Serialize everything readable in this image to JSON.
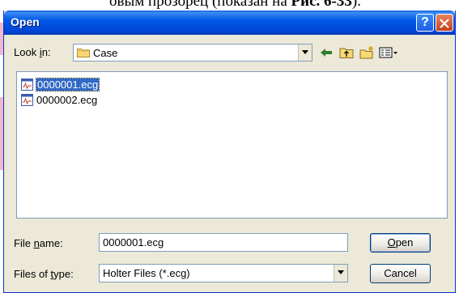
{
  "background_text": {
    "line": "овым прозорец (показан на ",
    "bold": "Рис. 6-33",
    "tail": ")."
  },
  "window": {
    "title": "Open",
    "help_label": "?",
    "close_label": "✕"
  },
  "lookin": {
    "label_pre": "Look ",
    "label_accel": "i",
    "label_post": "n:",
    "value": "Case"
  },
  "files": [
    {
      "name": "0000001.ecg",
      "selected": true
    },
    {
      "name": "0000002.ecg",
      "selected": false
    }
  ],
  "filename": {
    "label_pre": "File ",
    "label_accel": "n",
    "label_post": "ame:",
    "value": "0000001.ecg"
  },
  "filetype": {
    "label_pre": "Files of ",
    "label_accel": "t",
    "label_post": "ype:",
    "value": "Holter Files (*.ecg)"
  },
  "buttons": {
    "open_accel": "O",
    "open_rest": "pen",
    "cancel": "Cancel"
  },
  "colors": {
    "titlebar": "#0058e6",
    "selection": "#316ac5",
    "dialog_bg": "#ece9d8"
  },
  "icons": [
    "back-icon",
    "up-folder-icon",
    "new-folder-icon",
    "view-menu-icon",
    "folder-icon",
    "ecg-file-icon"
  ]
}
